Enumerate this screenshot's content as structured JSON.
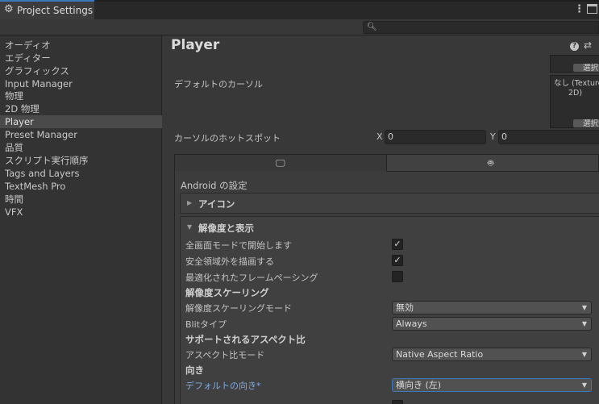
{
  "window": {
    "tab_title": "Project Settings",
    "search": {
      "value": "",
      "placeholder": ""
    }
  },
  "sidebar": {
    "items": [
      {
        "label": "オーディオ"
      },
      {
        "label": "エディター"
      },
      {
        "label": "グラフィックス"
      },
      {
        "label": "Input Manager"
      },
      {
        "label": "物理"
      },
      {
        "label": "2D 物理"
      },
      {
        "label": "Player",
        "selected": true
      },
      {
        "label": "Preset Manager"
      },
      {
        "label": "品質"
      },
      {
        "label": "スクリプト実行順序"
      },
      {
        "label": "Tags and Layers"
      },
      {
        "label": "TextMesh Pro"
      },
      {
        "label": "時間"
      },
      {
        "label": "VFX"
      }
    ]
  },
  "main": {
    "title": "Player",
    "select_label": "選択",
    "default_cursor": {
      "label": "デフォルトのカーソル",
      "value_line1": "なし (Texture",
      "value_line2": "2D)"
    },
    "hotspot": {
      "label": "カーソルのホットスポット",
      "x_label": "X",
      "x_value": "0",
      "y_label": "Y",
      "y_value": "0"
    },
    "platform_tabs": [
      {
        "icon": "monitor-icon",
        "selected": false
      },
      {
        "icon": "android-icon",
        "selected": true
      }
    ],
    "android_settings_title": "Android の設定",
    "foldout_icon": {
      "title": "アイコン",
      "expanded": false
    },
    "foldout_resolution": {
      "title": "解像度と表示",
      "expanded": true,
      "fullscreen": {
        "label": "全画面モードで開始します",
        "checked": true
      },
      "safe_area": {
        "label": "安全領域外を描画する",
        "checked": true
      },
      "frame_pacing": {
        "label": "最適化されたフレームペーシング",
        "checked": false
      },
      "scaling_header": "解像度スケーリング",
      "scaling_mode": {
        "label": "解像度スケーリングモード",
        "value": "無効"
      },
      "blit_type": {
        "label": "Blitタイプ",
        "value": "Always"
      },
      "aspect_header": "サポートされるアスペクト比",
      "aspect_mode": {
        "label": "アスペクト比モード",
        "value": "Native Aspect Ratio"
      },
      "orientation_header": "向き",
      "default_orientation": {
        "label": "デフォルトの向き*",
        "value": "横向き (左)"
      }
    }
  },
  "colors": {
    "accent": "#3a79bb",
    "modified_label": "#7fa9e0",
    "background": "#383838",
    "sidebar": "#333333"
  }
}
